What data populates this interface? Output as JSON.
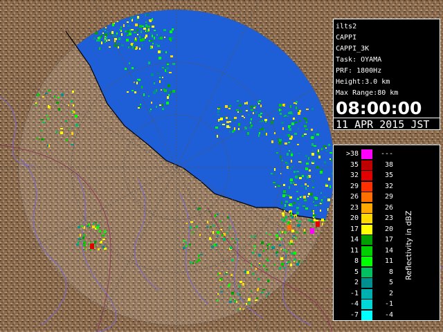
{
  "info": {
    "site": "ilts2",
    "product": "CAPPI",
    "product_id": "CAPPI_3K",
    "task": "Task: OYAMA",
    "prf": "PRF: 1800Hz",
    "height": "Height:3.0 km",
    "max_range": "Max Range:80 km",
    "time": "08:00:00",
    "date": "11 APR 2015 JST"
  },
  "legend": {
    "title": "Reflectivity in dBZ",
    "rows": [
      {
        "lo": ">38",
        "hi": "---",
        "color": "#ff00ff"
      },
      {
        "lo": "35",
        "hi": "38",
        "color": "#c00000"
      },
      {
        "lo": "32",
        "hi": "35",
        "color": "#e00000"
      },
      {
        "lo": "29",
        "hi": "32",
        "color": "#ff3000"
      },
      {
        "lo": "26",
        "hi": "29",
        "color": "#ff7000"
      },
      {
        "lo": "23",
        "hi": "26",
        "color": "#ffa800"
      },
      {
        "lo": "20",
        "hi": "23",
        "color": "#ffd800"
      },
      {
        "lo": "17",
        "hi": "20",
        "color": "#ffff00"
      },
      {
        "lo": "14",
        "hi": "17",
        "color": "#00a000"
      },
      {
        "lo": "11",
        "hi": "14",
        "color": "#00d000"
      },
      {
        "lo": "8",
        "hi": "11",
        "color": "#00ff00"
      },
      {
        "lo": "5",
        "hi": "8",
        "color": "#00c060"
      },
      {
        "lo": "2",
        "hi": "5",
        "color": "#009090"
      },
      {
        "lo": "-1",
        "hi": "2",
        "color": "#00b0b0"
      },
      {
        "lo": "-4",
        "hi": "-1",
        "color": "#00d8d8"
      },
      {
        "lo": "-7",
        "hi": "-4",
        "color": "#00ffff"
      }
    ]
  },
  "colors": {
    "sea": "#1e5fd8",
    "land": "#8a6a4c",
    "land_dark": "#5a4030",
    "land_light": "#b09070",
    "river": "#7a68d0",
    "boundary": "#8a3a5a",
    "range_ring": "#555555"
  }
}
